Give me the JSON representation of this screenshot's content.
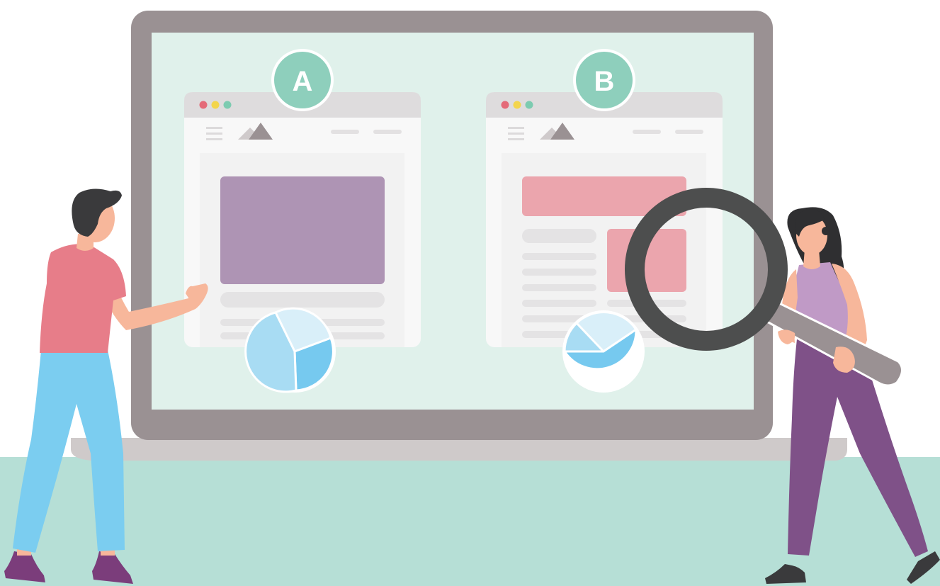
{
  "variants": [
    {
      "label": "A",
      "badge_color": "#8ecfbc",
      "accent_color": "#ae94b4"
    },
    {
      "label": "B",
      "badge_color": "#8ecfbc",
      "accent_color": "#eba5ad"
    }
  ],
  "colors": {
    "screen_bg": "#e0f1eb",
    "laptop_frame": "#9a9193",
    "floor": "#b6dfd6",
    "dot_red": "#e46a78",
    "dot_yellow": "#f3d54c",
    "dot_green": "#7ccbb0",
    "pie_light": "#d9eff9",
    "pie_mid": "#a8dcf3",
    "pie_dark": "#76c9ef",
    "magnifier": "#4d4e4e",
    "magnifier_handle": "#9a9193"
  },
  "icons": [
    "hamburger-menu-icon",
    "mountain-logo-icon",
    "pie-chart-icon",
    "magnifying-glass-icon"
  ]
}
